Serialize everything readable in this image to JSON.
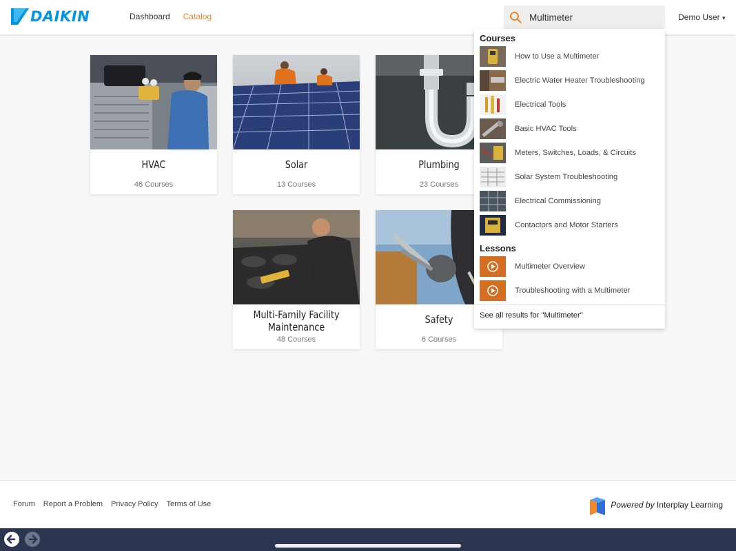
{
  "brand": {
    "name": "DAIKIN",
    "color": "#0097e0"
  },
  "nav": {
    "items": [
      "Dashboard",
      "Catalog"
    ],
    "active": "Catalog",
    "active_color": "#e8892e"
  },
  "search": {
    "value": "Multimeter",
    "placeholder": "Search",
    "icon": "search-icon"
  },
  "user": {
    "name": "Demo User",
    "caret": "▾"
  },
  "catalog": [
    {
      "title": "HVAC",
      "count": "46 Courses"
    },
    {
      "title": "Solar",
      "count": "13 Courses"
    },
    {
      "title": "Plumbing",
      "count": "23 Courses"
    },
    {
      "title": "Multi-Family Facility Maintenance",
      "count": "48 Courses"
    },
    {
      "title": "Safety",
      "count": "6 Courses"
    }
  ],
  "search_results": {
    "courses_heading": "Courses",
    "courses": [
      "How to Use a Multimeter",
      "Electric Water Heater Troubleshooting",
      "Electrical Tools",
      "Basic HVAC Tools",
      "Meters, Switches, Loads, & Circuits",
      "Solar System Troubleshooting",
      "Electrical Commissioning",
      "Contactors and Motor Starters"
    ],
    "lessons_heading": "Lessons",
    "lessons": [
      "Multimeter Overview",
      "Troubleshooting with a Multimeter"
    ],
    "see_all": "See all results for \"Multimeter\""
  },
  "footer": {
    "links": [
      "Forum",
      "Report a Problem",
      "Privacy Policy",
      "Terms of Use"
    ],
    "powered_prefix": "Powered by",
    "powered_brand": "Interplay Learning"
  },
  "browser": {
    "back_icon": "arrow-left-icon",
    "forward_icon": "arrow-right-icon"
  }
}
